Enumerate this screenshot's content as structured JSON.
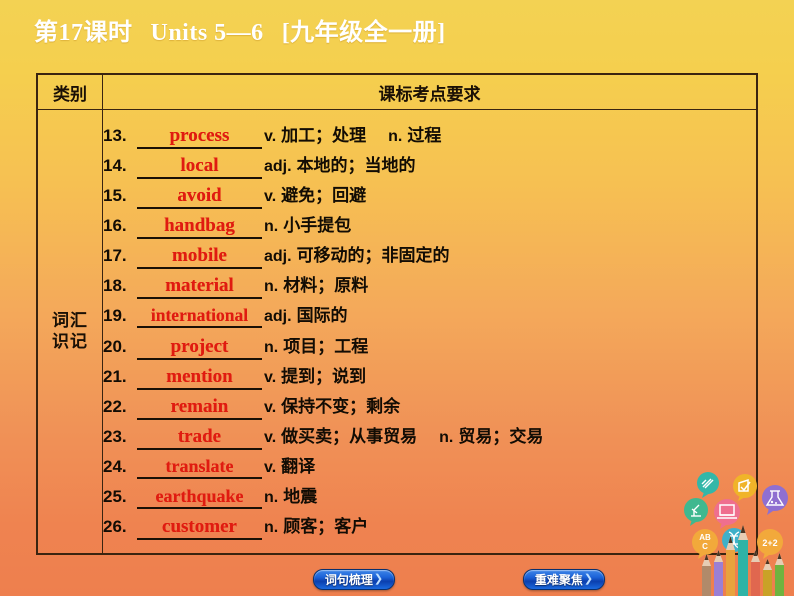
{
  "slide": {
    "title_lesson": "第17课时",
    "title_units": "Units 5—6",
    "title_book": "[九年级全一册]"
  },
  "table": {
    "header_category": "类别",
    "header_requirement": "课标考点要求",
    "category_line1": "词汇",
    "category_line2": "识记",
    "rows": [
      {
        "num": "13.",
        "word": "process",
        "pos": "v.",
        "meaning": "加工；处理",
        "pos2": "n.",
        "meaning2": "过程"
      },
      {
        "num": "14.",
        "word": "local",
        "pos": "adj.",
        "meaning": "本地的；当地的",
        "pos2": "",
        "meaning2": ""
      },
      {
        "num": "15.",
        "word": "avoid",
        "pos": "v.",
        "meaning": "避免；回避",
        "pos2": "",
        "meaning2": ""
      },
      {
        "num": "16.",
        "word": "handbag",
        "pos": "n.",
        "meaning": "小手提包",
        "pos2": "",
        "meaning2": ""
      },
      {
        "num": "17.",
        "word": "mobile",
        "pos": "adj.",
        "meaning": "可移动的；非固定的",
        "pos2": "",
        "meaning2": ""
      },
      {
        "num": "18.",
        "word": "material",
        "pos": "n.",
        "meaning": "材料；原料",
        "pos2": "",
        "meaning2": ""
      },
      {
        "num": "19.",
        "word": "international",
        "pos": "adj.",
        "meaning": "国际的",
        "pos2": "",
        "meaning2": ""
      },
      {
        "num": "20.",
        "word": "project",
        "pos": "n.",
        "meaning": "项目；工程",
        "pos2": "",
        "meaning2": ""
      },
      {
        "num": "21.",
        "word": "mention",
        "pos": "v.",
        "meaning": "提到；说到",
        "pos2": "",
        "meaning2": ""
      },
      {
        "num": "22.",
        "word": "remain",
        "pos": "v.",
        "meaning": "保持不变；剩余",
        "pos2": "",
        "meaning2": ""
      },
      {
        "num": "23.",
        "word": "trade",
        "pos": "v.",
        "meaning": "做买卖；从事贸易",
        "pos2": "n.",
        "meaning2": "贸易；交易"
      },
      {
        "num": "24.",
        "word": "translate",
        "pos": "v.",
        "meaning": "翻译",
        "pos2": "",
        "meaning2": ""
      },
      {
        "num": "25.",
        "word": "earthquake",
        "pos": "n.",
        "meaning": "地震",
        "pos2": "",
        "meaning2": ""
      },
      {
        "num": "26.",
        "word": "customer",
        "pos": "n.",
        "meaning": "顾客；客户",
        "pos2": "",
        "meaning2": ""
      }
    ]
  },
  "nav": {
    "sentence_label": "词句梳理",
    "focus_label": "重难聚焦",
    "arrow": "❯"
  },
  "colors": {
    "background_top": "#f3d253",
    "background_bottom": "#ee7f4e",
    "answer_red": "#e01b10",
    "table_border": "#3a2410",
    "button_blue": "#1c63d8"
  },
  "decor": {
    "bubbles": [
      "book-icon",
      "laptop-icon",
      "abc-icon",
      "dna-icon",
      "pencil-check-icon",
      "flask-icon",
      "math-2plus2-icon"
    ],
    "math_label": "2+2",
    "abc_label": "ABC"
  }
}
